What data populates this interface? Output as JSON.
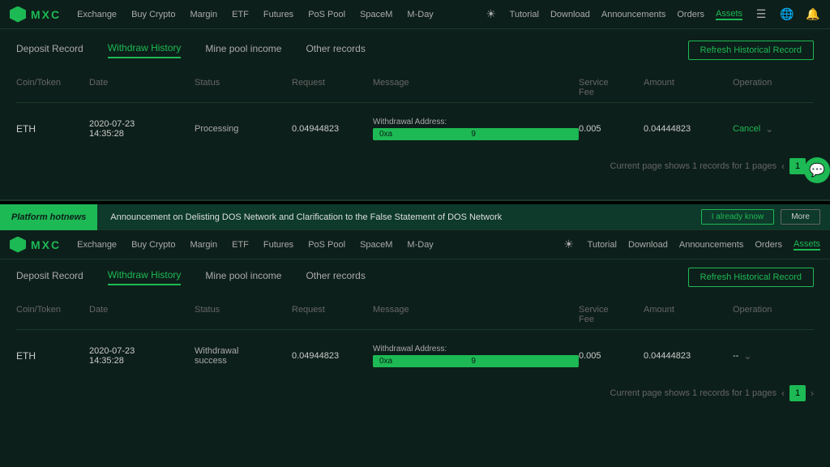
{
  "brand": {
    "name": "MXC"
  },
  "navbar": {
    "items": [
      {
        "label": "Exchange",
        "active": false
      },
      {
        "label": "Buy Crypto",
        "active": false
      },
      {
        "label": "Margin",
        "active": false
      },
      {
        "label": "ETF",
        "active": false
      },
      {
        "label": "Futures",
        "active": false
      },
      {
        "label": "PoS Pool",
        "active": false
      },
      {
        "label": "SpaceM",
        "active": false
      },
      {
        "label": "M-Day",
        "active": false
      }
    ],
    "right_items": [
      {
        "label": "Tutorial",
        "active": false
      },
      {
        "label": "Download",
        "active": false
      },
      {
        "label": "Announcements",
        "active": false
      },
      {
        "label": "Orders",
        "active": false
      },
      {
        "label": "Assets",
        "active": true
      }
    ]
  },
  "tabs": {
    "items": [
      {
        "label": "Deposit Record",
        "active": false
      },
      {
        "label": "Withdraw History",
        "active": true
      },
      {
        "label": "Mine pool income",
        "active": false
      },
      {
        "label": "Other records",
        "active": false
      }
    ],
    "refresh_button": "Refresh Historical Record"
  },
  "table": {
    "headers": [
      {
        "label": "Coin/Token"
      },
      {
        "label": "Date"
      },
      {
        "label": "Status"
      },
      {
        "label": "Request"
      },
      {
        "label": "Message"
      },
      {
        "label": "Service Fee"
      },
      {
        "label": "Amount"
      },
      {
        "label": "Operation"
      }
    ],
    "rows": [
      {
        "coin": "ETH",
        "date": "2020-07-23",
        "time": "14:35:28",
        "status": "Processing",
        "request": "0.04944823",
        "address_label": "Withdrawal Address:",
        "address_value": "0xa...",
        "address_suffix": "9",
        "service_fee": "0.005",
        "amount": "0.04444823",
        "operation_cancel": "Cancel"
      }
    ],
    "pagination": {
      "text": "Current page shows 1 records for 1 pages",
      "page": "1"
    }
  },
  "hotnews": {
    "label": "Platform hotnews",
    "text": "Announcement on Delisting DOS Network and Clarification to the False Statement of DOS Network",
    "know_button": "I already know",
    "more_button": "More"
  },
  "bottom_table": {
    "rows": [
      {
        "coin": "ETH",
        "date": "2020-07-23",
        "time": "14:35:28",
        "status_line1": "Withdrawal",
        "status_line2": "success",
        "request": "0.04944823",
        "address_label": "Withdrawal Address:",
        "address_value": "0xa...",
        "address_suffix": "9",
        "service_fee": "0.005",
        "amount": "0.04444823",
        "operation": "--"
      }
    ],
    "pagination": {
      "text": "Current page shows 1 records for 1 pages",
      "page": "1"
    }
  }
}
